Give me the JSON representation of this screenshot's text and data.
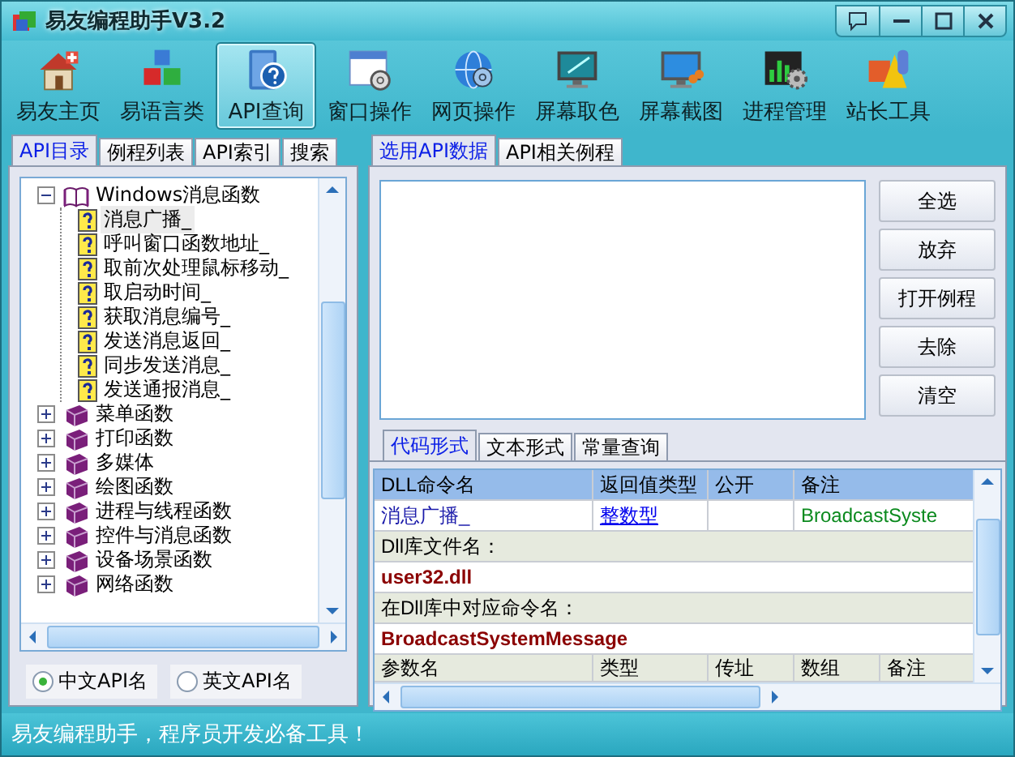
{
  "window": {
    "title": "易友编程助手V3.2"
  },
  "toolbar": [
    {
      "label": "易友主页",
      "selected": false
    },
    {
      "label": "易语言类",
      "selected": false
    },
    {
      "label": "API查询",
      "selected": true
    },
    {
      "label": "窗口操作",
      "selected": false
    },
    {
      "label": "网页操作",
      "selected": false
    },
    {
      "label": "屏幕取色",
      "selected": false
    },
    {
      "label": "屏幕截图",
      "selected": false
    },
    {
      "label": "进程管理",
      "selected": false
    },
    {
      "label": "站长工具",
      "selected": false
    }
  ],
  "left_tabs": [
    {
      "label": "API目录",
      "selected": true
    },
    {
      "label": "例程列表",
      "selected": false
    },
    {
      "label": "API索引",
      "selected": false
    },
    {
      "label": "搜索",
      "selected": false
    }
  ],
  "tree": [
    {
      "label": "Windows消息函数",
      "expanded": true,
      "children": [
        {
          "label": "消息广播_",
          "selected": true
        },
        {
          "label": "呼叫窗口函数地址_",
          "selected": false
        },
        {
          "label": "取前次处理鼠标移动_",
          "selected": false
        },
        {
          "label": "取启动时间_",
          "selected": false
        },
        {
          "label": "获取消息编号_",
          "selected": false
        },
        {
          "label": "发送消息返回_",
          "selected": false
        },
        {
          "label": "同步发送消息_",
          "selected": false
        },
        {
          "label": "发送通报消息_",
          "selected": false
        }
      ]
    },
    {
      "label": "菜单函数",
      "expanded": false
    },
    {
      "label": "打印函数",
      "expanded": false
    },
    {
      "label": "多媒体",
      "expanded": false
    },
    {
      "label": "绘图函数",
      "expanded": false
    },
    {
      "label": "进程与线程函数",
      "expanded": false
    },
    {
      "label": "控件与消息函数",
      "expanded": false
    },
    {
      "label": "设备场景函数",
      "expanded": false
    },
    {
      "label": "网络函数",
      "expanded": false
    }
  ],
  "name_language": [
    {
      "label": "中文API名",
      "selected": true
    },
    {
      "label": "英文API名",
      "selected": false
    }
  ],
  "right_tabs": [
    {
      "label": "选用API数据",
      "selected": true
    },
    {
      "label": "API相关例程",
      "selected": false
    }
  ],
  "buttons": [
    "全选",
    "放弃",
    "打开例程",
    "去除",
    "清空"
  ],
  "bottom_tabs": [
    {
      "label": "代码形式",
      "selected": true
    },
    {
      "label": "文本形式",
      "selected": false
    },
    {
      "label": "常量查询",
      "selected": false
    }
  ],
  "grid": {
    "columns": [
      "DLL命令名",
      "返回值类型",
      "公开",
      "备注"
    ],
    "rows": [
      {
        "kind": "record",
        "cells": [
          "消息广播_",
          "整数型",
          "",
          "BroadcastSyste"
        ]
      },
      {
        "kind": "label",
        "text": "Dll库文件名："
      },
      {
        "kind": "value",
        "text": "user32.dll"
      },
      {
        "kind": "label",
        "text": "在Dll库中对应命令名："
      },
      {
        "kind": "value",
        "text": "BroadcastSystemMessage"
      },
      {
        "kind": "header",
        "cells": [
          "参数名",
          "类型",
          "传址",
          "数组",
          "备注"
        ]
      }
    ]
  },
  "status_bar": "易友编程助手，程序员开发必备工具！"
}
